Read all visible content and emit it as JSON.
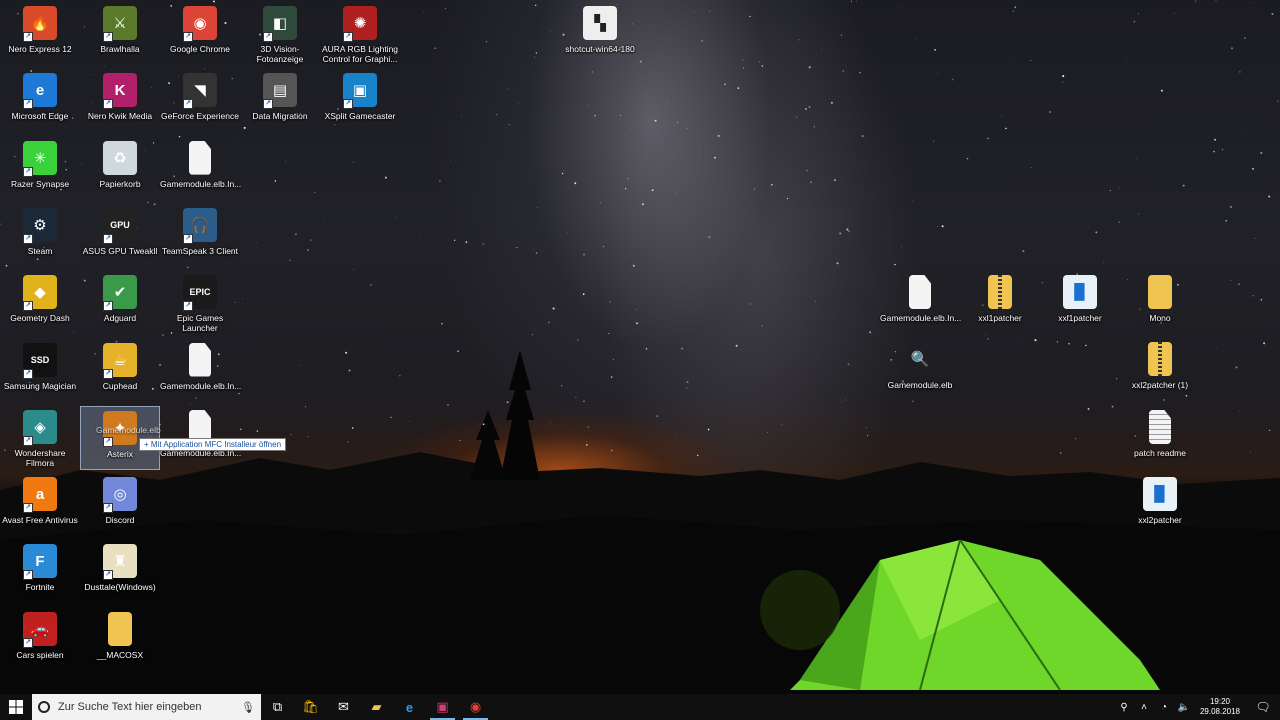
{
  "desktop_left": [
    {
      "label": "Nero Express 12",
      "icon": "nero-flame-icon",
      "color": "#d94a2a",
      "text": "🔥"
    },
    {
      "label": "Brawlhalla",
      "icon": "brawlhalla-icon",
      "color": "#5a7a2a",
      "text": "⚔"
    },
    {
      "label": "Google Chrome",
      "icon": "chrome-icon",
      "color": "#db4437",
      "text": "◉"
    },
    {
      "label": "3D Vision-Fotoanzeige",
      "icon": "nvidia-3d-vision-icon",
      "color": "#2f4a3a",
      "text": "◧"
    },
    {
      "label": "AURA RGB Lighting Control for Graphi...",
      "icon": "aura-rgb-icon",
      "color": "#b02020",
      "text": "✺"
    },
    {
      "label": "Microsoft Edge",
      "icon": "edge-icon",
      "color": "#1e78d6",
      "text": "e"
    },
    {
      "label": "Nero Kwik Media",
      "icon": "nero-kwik-media-icon",
      "color": "#b3206a",
      "text": "K"
    },
    {
      "label": "GeForce Experience",
      "icon": "geforce-icon",
      "color": "#333333",
      "text": "◥"
    },
    {
      "label": "Data Migration",
      "icon": "data-migration-icon",
      "color": "#555555",
      "text": "▤"
    },
    {
      "label": "XSplit Gamecaster",
      "icon": "xsplit-icon",
      "color": "#1a82c9",
      "text": "▣"
    },
    {
      "label": "Razer Synapse",
      "icon": "razer-icon",
      "color": "#3bd13b",
      "text": "✳"
    },
    {
      "label": "Papierkorb",
      "icon": "recycle-bin-icon",
      "color": "#cfd8dc",
      "text": "♻"
    },
    {
      "label": "Gamemodule.elb.In...",
      "icon": "file-icon",
      "color": "#f4f4f4",
      "text": ""
    },
    {
      "label": "Steam",
      "icon": "steam-icon",
      "color": "#1b2838",
      "text": "⚙"
    },
    {
      "label": "ASUS GPU Tweakll",
      "icon": "asus-gpu-tweak-icon",
      "color": "#222222",
      "text": "GPU"
    },
    {
      "label": "TeamSpeak 3 Client",
      "icon": "teamspeak-icon",
      "color": "#2a5d8a",
      "text": "🎧"
    },
    {
      "label": "Geometry Dash",
      "icon": "geometry-dash-icon",
      "color": "#e0b21b",
      "text": "◆"
    },
    {
      "label": "Adguard",
      "icon": "adguard-shield-icon",
      "color": "#3a9a4a",
      "text": "✔"
    },
    {
      "label": "Epic Games Launcher",
      "icon": "epic-games-icon",
      "color": "#1a1a1a",
      "text": "EPIC"
    },
    {
      "label": "Samsung Magician",
      "icon": "samsung-magician-icon",
      "color": "#111111",
      "text": "SSD"
    },
    {
      "label": "Cuphead",
      "icon": "cuphead-icon",
      "color": "#e5b22a",
      "text": "☕"
    },
    {
      "label": "Gamemodule.elb.In...",
      "icon": "file-icon",
      "color": "#f4f4f4",
      "text": ""
    },
    {
      "label": "Wondershare Filmora",
      "icon": "filmora-icon",
      "color": "#2b8a8a",
      "text": "◈"
    },
    {
      "label": "Asterix",
      "icon": "asterix-icon",
      "color": "#d07a20",
      "text": "✦"
    },
    {
      "label": "Gamemodule.elb.In...",
      "icon": "file-icon",
      "color": "#f4f4f4",
      "text": ""
    },
    {
      "label": "Avast Free Antivirus",
      "icon": "avast-icon",
      "color": "#f07a10",
      "text": "a"
    },
    {
      "label": "Discord",
      "icon": "discord-icon",
      "color": "#7289da",
      "text": "◎"
    },
    {
      "label": "Fortnite",
      "icon": "fortnite-icon",
      "color": "#2a8ad6",
      "text": "F"
    },
    {
      "label": "Dusttale(Windows)",
      "icon": "dusttale-icon",
      "color": "#e8e0c0",
      "text": "♜"
    },
    {
      "label": "Cars spielen",
      "icon": "cars-icon",
      "color": "#c02020",
      "text": "🚗"
    },
    {
      "label": "__MACOSX",
      "icon": "folder-icon",
      "color": "#f0c450",
      "text": ""
    }
  ],
  "desktop_right": [
    {
      "label": "shotcut-win64-180",
      "icon": "shotcut-icon"
    },
    {
      "label": "Gamemodule.elb.In...",
      "icon": "file-icon"
    },
    {
      "label": "xxl1patcher",
      "icon": "zip-folder-icon"
    },
    {
      "label": "xxl1patcher",
      "icon": "patcher-app-icon"
    },
    {
      "label": "Mono",
      "icon": "folder-icon"
    },
    {
      "label": "Gamemodule.elb",
      "icon": "magnifier-file-icon"
    },
    {
      "label": "xxl2patcher (1)",
      "icon": "zip-folder-icon"
    },
    {
      "label": "patch readme",
      "icon": "text-file-icon"
    },
    {
      "label": "xxl2patcher",
      "icon": "patcher-app-icon"
    }
  ],
  "drag": {
    "ghost_label": "Gamemodule.elb",
    "tooltip": "+ Mit Application MFC Installeur öffnen"
  },
  "taskbar": {
    "search_placeholder": "Zur Suche Text hier eingeben",
    "time": "19:20",
    "date": "29.08.2018",
    "pinned": [
      "task-view-icon",
      "store-icon",
      "mail-icon",
      "file-explorer-icon",
      "edge-icon",
      "app-icon",
      "chrome-icon"
    ]
  }
}
